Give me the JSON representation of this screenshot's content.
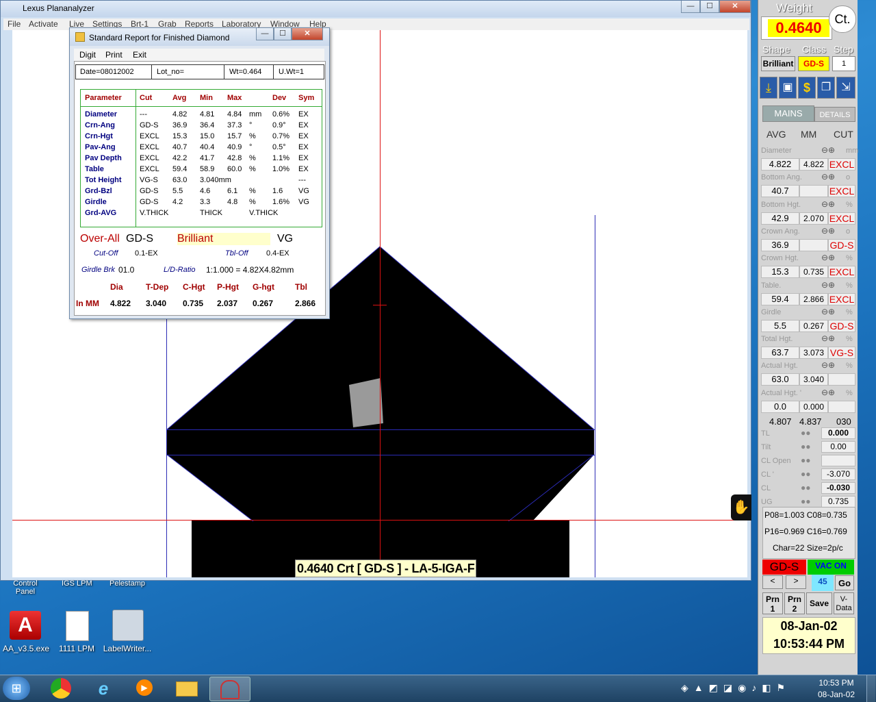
{
  "app": {
    "title": "Lexus Plananalyzer",
    "window_buttons": [
      "—",
      "☐",
      "✕"
    ]
  },
  "menu": [
    "File",
    "Activate",
    "Live",
    "Settings",
    "Brt-1",
    "Grab",
    "Reports",
    "Laboratory",
    "Window",
    "Help"
  ],
  "canvas": {
    "overlay_label": "0.4640 Crt [ GD-S  ] - LA-5-IGA-F"
  },
  "report": {
    "title": "Standard  Report for Finished Diamond",
    "menu": [
      "Digit",
      "Print",
      "Exit"
    ],
    "header": [
      "Date=08012002",
      "Lot_no=",
      "Wt=0.464",
      "U.Wt=1"
    ],
    "columns": [
      "Parameter",
      "Cut",
      "Avg",
      "Min",
      "Max",
      "",
      "Dev",
      "Sym"
    ],
    "rows": [
      [
        "Diameter",
        "---",
        "4.82",
        "4.81",
        "4.84",
        "mm",
        "0.6%",
        "EX"
      ],
      [
        "Crn-Ang",
        "GD-S",
        "36.9",
        "36.4",
        "37.3",
        "°",
        "0.9°",
        "EX"
      ],
      [
        "Crn-Hgt",
        "EXCL",
        "15.3",
        "15.0",
        "15.7",
        "%",
        "0.7%",
        "EX"
      ],
      [
        "Pav-Ang",
        "EXCL",
        "40.7",
        "40.4",
        "40.9",
        "°",
        "0.5°",
        "EX"
      ],
      [
        "Pav Depth",
        "EXCL",
        "42.2",
        "41.7",
        "42.8",
        "%",
        "1.1%",
        "EX"
      ],
      [
        "Table",
        "EXCL",
        "59.4",
        "58.9",
        "60.0",
        "%",
        "1.0%",
        "EX"
      ],
      [
        "Tot Height",
        "VG-S",
        "63.0",
        "3.040mm",
        "",
        "",
        "",
        "---"
      ],
      [
        "Grd-Bzl",
        "GD-S",
        "5.5",
        "4.6",
        "6.1",
        "%",
        "1.6",
        "VG"
      ],
      [
        "Girdle",
        "GD-S",
        "4.2",
        "3.3",
        "4.8",
        "%",
        "1.6%",
        "VG"
      ],
      [
        "Grd-AVG",
        "V.THICK",
        "",
        "THICK",
        "",
        "V.THICK",
        "",
        ""
      ]
    ],
    "overall_label": "Over-All",
    "overall_grade": "GD-S",
    "shape": "Brilliant",
    "overall_sym": "VG",
    "cutoff_label": "Cut-Off",
    "cutoff_val": "0.1-EX",
    "tbl_off_label": "Tbl-Off",
    "tbl_off_val": "0.4-EX",
    "girdle_brk_label": "Girdle Brk",
    "girdle_brk_val": "01.0",
    "ld_label": "L/D-Ratio",
    "ld_val": "1:1.000 = 4.82X4.82mm",
    "mm_headers": [
      "Dia",
      "T-Dep",
      "C-Hgt",
      "P-Hgt",
      "G-hgt",
      "Tbl"
    ],
    "mm_label": "In MM",
    "mm_values": [
      "4.822",
      "3.040",
      "0.735",
      "2.037",
      "0.267",
      "2.866"
    ]
  },
  "panel": {
    "weight_label": "Weight",
    "weight_value": "0.4640",
    "ct_label": "Ct.",
    "shape_label": "Shape",
    "class_label": "Class",
    "step_label": "Step",
    "shape_value": "Brilliant",
    "class_value": "GD-S",
    "step_value": "1",
    "tab_mains": "MAINS",
    "tab_details": "DETAILS",
    "col_avg": "AVG",
    "col_mm": "MM",
    "col_cut": "CUT",
    "params": [
      {
        "label": "Diameter",
        "unit": "mm",
        "v1": "4.822",
        "v2": "4.822",
        "cut": "EXCL"
      },
      {
        "label": "Bottom Ang.",
        "unit": "o",
        "v1": "40.7",
        "v2": "",
        "cut": "EXCL"
      },
      {
        "label": "Bottom Hgt.",
        "unit": "%",
        "v1": "42.9",
        "v2": "2.070",
        "cut": "EXCL"
      },
      {
        "label": "Crown Ang.",
        "unit": "o",
        "v1": "36.9",
        "v2": "",
        "cut": "GD-S"
      },
      {
        "label": "Crown Hgt.",
        "unit": "%",
        "v1": "15.3",
        "v2": "0.735",
        "cut": "EXCL"
      },
      {
        "label": "Table.",
        "unit": "%",
        "v1": "59.4",
        "v2": "2.866",
        "cut": "EXCL"
      },
      {
        "label": "Girdle",
        "unit": "%",
        "v1": "5.5",
        "v2": "0.267",
        "cut": "GD-S"
      },
      {
        "label": "Total Hgt.",
        "unit": "%",
        "v1": "63.7",
        "v2": "3.073",
        "cut": "VG-S"
      },
      {
        "label": "Actual Hgt.",
        "unit": "%",
        "v1": "63.0",
        "v2": "3.040",
        "cut": ""
      },
      {
        "label": "Actual Hgt. '",
        "unit": "%",
        "v1": "0.0",
        "v2": "0.000",
        "cut": ""
      }
    ],
    "extra_row": [
      "4.807",
      "4.837",
      "030"
    ],
    "small_rows": [
      {
        "label": "TL",
        "value": "0.000"
      },
      {
        "label": "Tilt",
        "value": "0.00"
      },
      {
        "label": "CL Open",
        "value": ""
      },
      {
        "label": "CL '",
        "value": "-3.070"
      },
      {
        "label": "CL",
        "value": "-0.030"
      },
      {
        "label": "UG",
        "value": "0.735"
      }
    ],
    "p08": "P08=1.003 C08=0.735",
    "p16": "P16=0.969 C16=0.769",
    "char": "Char=22  Size=2p/c",
    "grade": "GD-S",
    "vac": "VAC ON",
    "prev": "<",
    "next": ">",
    "count": "45",
    "go": "Go",
    "prn1": "Prn 1",
    "prn2": "Prn 2",
    "save": "Save",
    "vdata": "V-Data",
    "date": "08-Jan-02",
    "time": "10:53:44 PM"
  },
  "desktop": {
    "icons": [
      {
        "label": "AA_v3.5.exe"
      },
      {
        "label": "1111 LPM"
      },
      {
        "label": "LabelWriter..."
      }
    ],
    "partial": [
      "Control Panel",
      "IGS LPM",
      "Pelestamp"
    ]
  },
  "taskbar": {
    "clock_time": "10:53 PM",
    "clock_date": "08-Jan-02"
  }
}
